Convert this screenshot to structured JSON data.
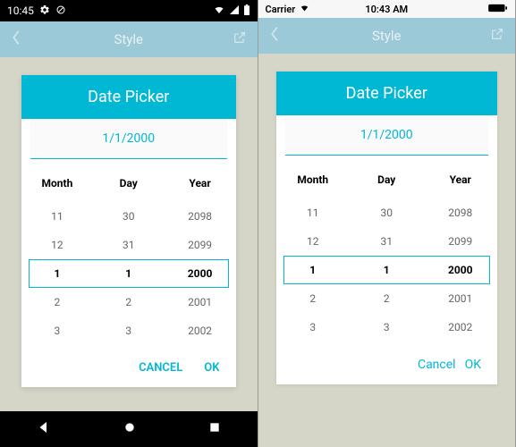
{
  "android": {
    "status": {
      "time": "10:45"
    },
    "header": {
      "title": "Style"
    },
    "card": {
      "title": "Date Picker",
      "selected": "1/1/2000",
      "columns": [
        "Month",
        "Day",
        "Year"
      ],
      "rows": [
        {
          "vals": [
            "11",
            "30",
            "2098"
          ],
          "selected": false
        },
        {
          "vals": [
            "12",
            "31",
            "2099"
          ],
          "selected": false
        },
        {
          "vals": [
            "1",
            "1",
            "2000"
          ],
          "selected": true
        },
        {
          "vals": [
            "2",
            "2",
            "2001"
          ],
          "selected": false
        },
        {
          "vals": [
            "3",
            "3",
            "2002"
          ],
          "selected": false
        }
      ],
      "actions": {
        "cancel": "CANCEL",
        "ok": "OK"
      }
    }
  },
  "ios": {
    "status": {
      "carrier": "Carrier",
      "time": "10:43 AM"
    },
    "header": {
      "title": "Style"
    },
    "card": {
      "title": "Date Picker",
      "selected": "1/1/2000",
      "columns": [
        "Month",
        "Day",
        "Year"
      ],
      "rows": [
        {
          "vals": [
            "11",
            "30",
            "2098"
          ],
          "selected": false
        },
        {
          "vals": [
            "12",
            "31",
            "2099"
          ],
          "selected": false
        },
        {
          "vals": [
            "1",
            "1",
            "2000"
          ],
          "selected": true
        },
        {
          "vals": [
            "2",
            "2",
            "2001"
          ],
          "selected": false
        },
        {
          "vals": [
            "3",
            "3",
            "2002"
          ],
          "selected": false
        }
      ],
      "actions": {
        "cancel": "Cancel",
        "ok": "OK"
      }
    }
  }
}
